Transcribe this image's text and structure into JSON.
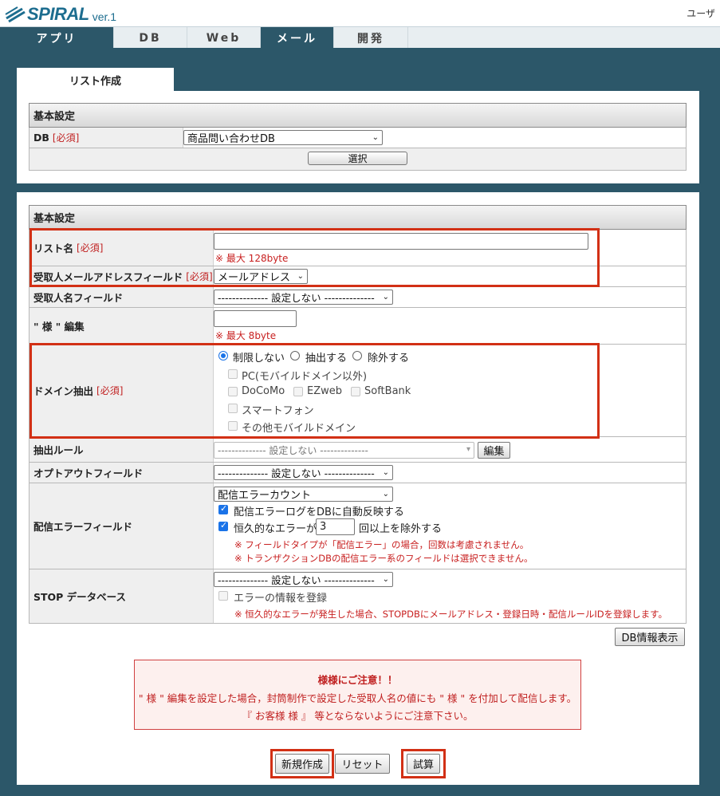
{
  "header": {
    "logo_text": "SPIRAL",
    "logo_version": "ver.1",
    "user_label": "ユーザ"
  },
  "nav": {
    "tabs": [
      {
        "label": "アプリ",
        "state": "active"
      },
      {
        "label": "DB",
        "state": "normal"
      },
      {
        "label": "Web",
        "state": "normal"
      },
      {
        "label": "メール",
        "state": "selected"
      },
      {
        "label": "開発",
        "state": "normal"
      }
    ]
  },
  "page_tab": "リスト作成",
  "panel1": {
    "section_title": "基本設定",
    "db_label": "DB",
    "required": "[必須]",
    "db_value": "商品問い合わせDB",
    "select_button": "選択"
  },
  "panel2": {
    "section_title": "基本設定",
    "required": "[必須]",
    "list_name": {
      "label": "リスト名",
      "value": "",
      "hint": "※ 最大 128byte"
    },
    "recipient_email": {
      "label": "受取人メールアドレスフィールド",
      "value": "メールアドレス"
    },
    "recipient_name": {
      "label": "受取人名フィールド",
      "value": "-------------- 設定しない --------------"
    },
    "sama": {
      "label": "\" 様 \" 編集",
      "value": "",
      "hint": "※ 最大 8byte"
    },
    "domain": {
      "label": "ドメイン抽出",
      "radios": [
        {
          "label": "制限しない",
          "checked": true
        },
        {
          "label": "抽出する",
          "checked": false
        },
        {
          "label": "除外する",
          "checked": false
        }
      ],
      "checkboxes": [
        {
          "label": "PC(モバイルドメイン以外)",
          "checked": false
        },
        {
          "label": "DoCoMo",
          "checked": false
        },
        {
          "label": "EZweb",
          "checked": false
        },
        {
          "label": "SoftBank",
          "checked": false
        },
        {
          "label": "スマートフォン",
          "checked": false
        },
        {
          "label": "その他モバイルドメイン",
          "checked": false
        }
      ]
    },
    "extract_rule": {
      "label": "抽出ルール",
      "value": "-------------- 設定しない --------------",
      "edit_button": "編集"
    },
    "optout": {
      "label": "オプトアウトフィールド",
      "value": "-------------- 設定しない --------------"
    },
    "error_field": {
      "label": "配信エラーフィールド",
      "value": "配信エラーカウント",
      "check1": "配信エラーログをDBに自動反映する",
      "check2_prefix": "恒久的なエラーが",
      "check2_value": "3",
      "check2_suffix": "回以上を除外する",
      "note1": "※ フィールドタイプが「配信エラー」の場合，回数は考慮されません。",
      "note2": "※ トランザクションDBの配信エラー系のフィールドは選択できません。"
    },
    "stop_db": {
      "label": "STOP データベース",
      "value": "-------------- 設定しない --------------",
      "check": "エラーの情報を登録",
      "note": "※ 恒久的なエラーが発生した場合、STOPDBにメールアドレス・登録日時・配信ルールIDを登録します。"
    },
    "db_info_button": "DB情報表示",
    "notice": {
      "title": "様様にご注意！！",
      "line1": "\" 様 \" 編集を設定した場合，封筒制作で設定した受取人名の値にも \" 様 \" を付加して配信します。",
      "line2": "『 お客様 様 』 等とならないようにご注意下さい。"
    },
    "buttons": {
      "create": "新規作成",
      "reset": "リセット",
      "trial": "試算"
    }
  },
  "colors": {
    "accent": "#2c5769",
    "highlight_border": "#d23015",
    "required_text": "#c02020"
  }
}
